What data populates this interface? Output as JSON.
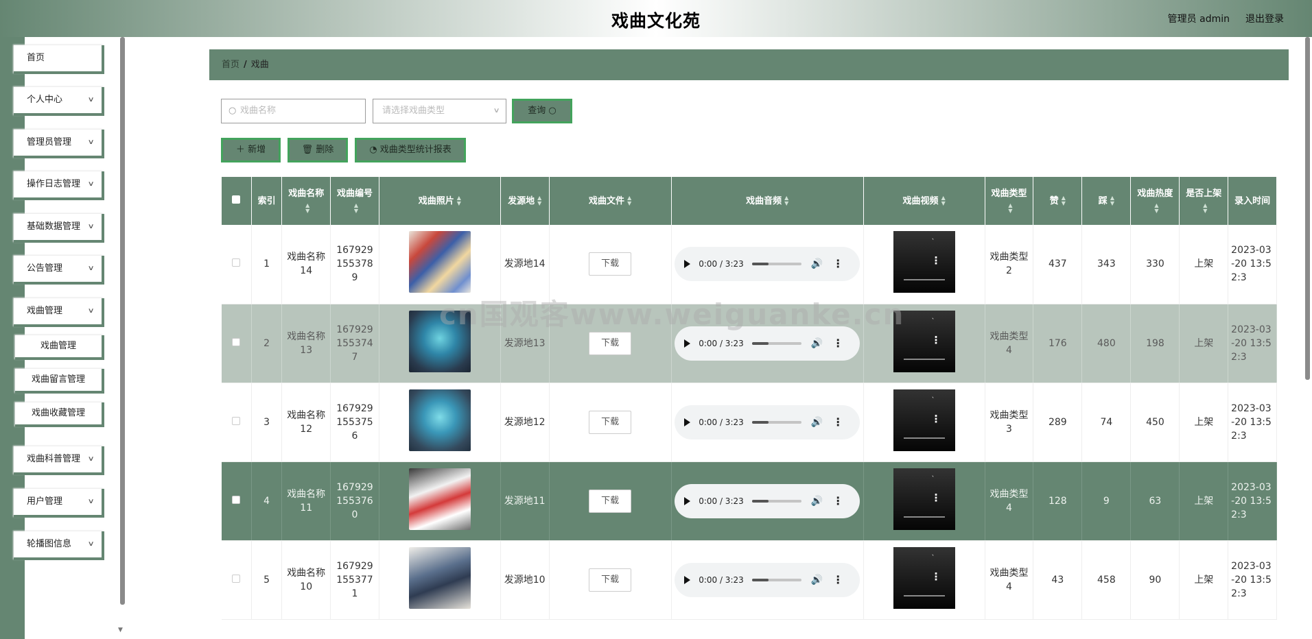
{
  "header": {
    "title": "戏曲文化苑",
    "admin_label": "管理员 admin",
    "logout_label": "退出登录"
  },
  "sidebar": {
    "items": [
      {
        "label": "首页",
        "has_children": false
      },
      {
        "label": "个人中心",
        "has_children": true
      },
      {
        "label": "管理员管理",
        "has_children": true
      },
      {
        "label": "操作日志管理",
        "has_children": true
      },
      {
        "label": "基础数据管理",
        "has_children": true
      },
      {
        "label": "公告管理",
        "has_children": true
      },
      {
        "label": "戏曲管理",
        "has_children": true,
        "expanded": true
      },
      {
        "label": "戏曲科普管理",
        "has_children": true
      },
      {
        "label": "用户管理",
        "has_children": true
      },
      {
        "label": "轮播图信息",
        "has_children": true
      }
    ],
    "sub_items": [
      "戏曲管理",
      "戏曲留言管理",
      "戏曲收藏管理"
    ]
  },
  "breadcrumb": {
    "home": "首页",
    "separator": "/",
    "current": "戏曲"
  },
  "search": {
    "name_placeholder": "戏曲名称",
    "type_placeholder": "请选择戏曲类型",
    "query_button": "查询"
  },
  "actions": {
    "add": "新增",
    "delete": "删除",
    "report": "戏曲类型统计报表"
  },
  "table": {
    "headers": {
      "index": "索引",
      "name": "戏曲名称",
      "code": "戏曲编号",
      "photo": "戏曲照片",
      "origin": "发源地",
      "file": "戏曲文件",
      "audio": "戏曲音频",
      "video": "戏曲视频",
      "type": "戏曲类型",
      "likes": "赞",
      "dislikes": "踩",
      "heat": "戏曲热度",
      "listed": "是否上架",
      "time": "录入时间"
    },
    "download_label": "下载",
    "audio_time": "0:00 / 3:23",
    "rows": [
      {
        "index": "1",
        "name": "戏曲名称14",
        "code": "1679291553789",
        "origin": "发源地14",
        "type": "戏曲类型2",
        "likes": "437",
        "dislikes": "343",
        "heat": "330",
        "listed": "上架",
        "time": "2023-03-20 13:52:3"
      },
      {
        "index": "2",
        "name": "戏曲名称13",
        "code": "1679291553747",
        "origin": "发源地13",
        "type": "戏曲类型4",
        "likes": "176",
        "dislikes": "480",
        "heat": "198",
        "listed": "上架",
        "time": "2023-03-20 13:52:3"
      },
      {
        "index": "3",
        "name": "戏曲名称12",
        "code": "1679291553756",
        "origin": "发源地12",
        "type": "戏曲类型3",
        "likes": "289",
        "dislikes": "74",
        "heat": "450",
        "listed": "上架",
        "time": "2023-03-20 13:52:3"
      },
      {
        "index": "4",
        "name": "戏曲名称11",
        "code": "1679291553760",
        "origin": "发源地11",
        "type": "戏曲类型4",
        "likes": "128",
        "dislikes": "9",
        "heat": "63",
        "listed": "上架",
        "time": "2023-03-20 13:52:3"
      },
      {
        "index": "5",
        "name": "戏曲名称10",
        "code": "1679291553771",
        "origin": "发源地10",
        "type": "戏曲类型4",
        "likes": "43",
        "dislikes": "458",
        "heat": "90",
        "listed": "上架",
        "time": "2023-03-20 13:52:3"
      }
    ]
  },
  "watermark": "cn国观客www.weiguanke.cn",
  "colors": {
    "accent": "#658672",
    "accent_border": "#43a35c",
    "row_grey": "#b8c5bc"
  }
}
